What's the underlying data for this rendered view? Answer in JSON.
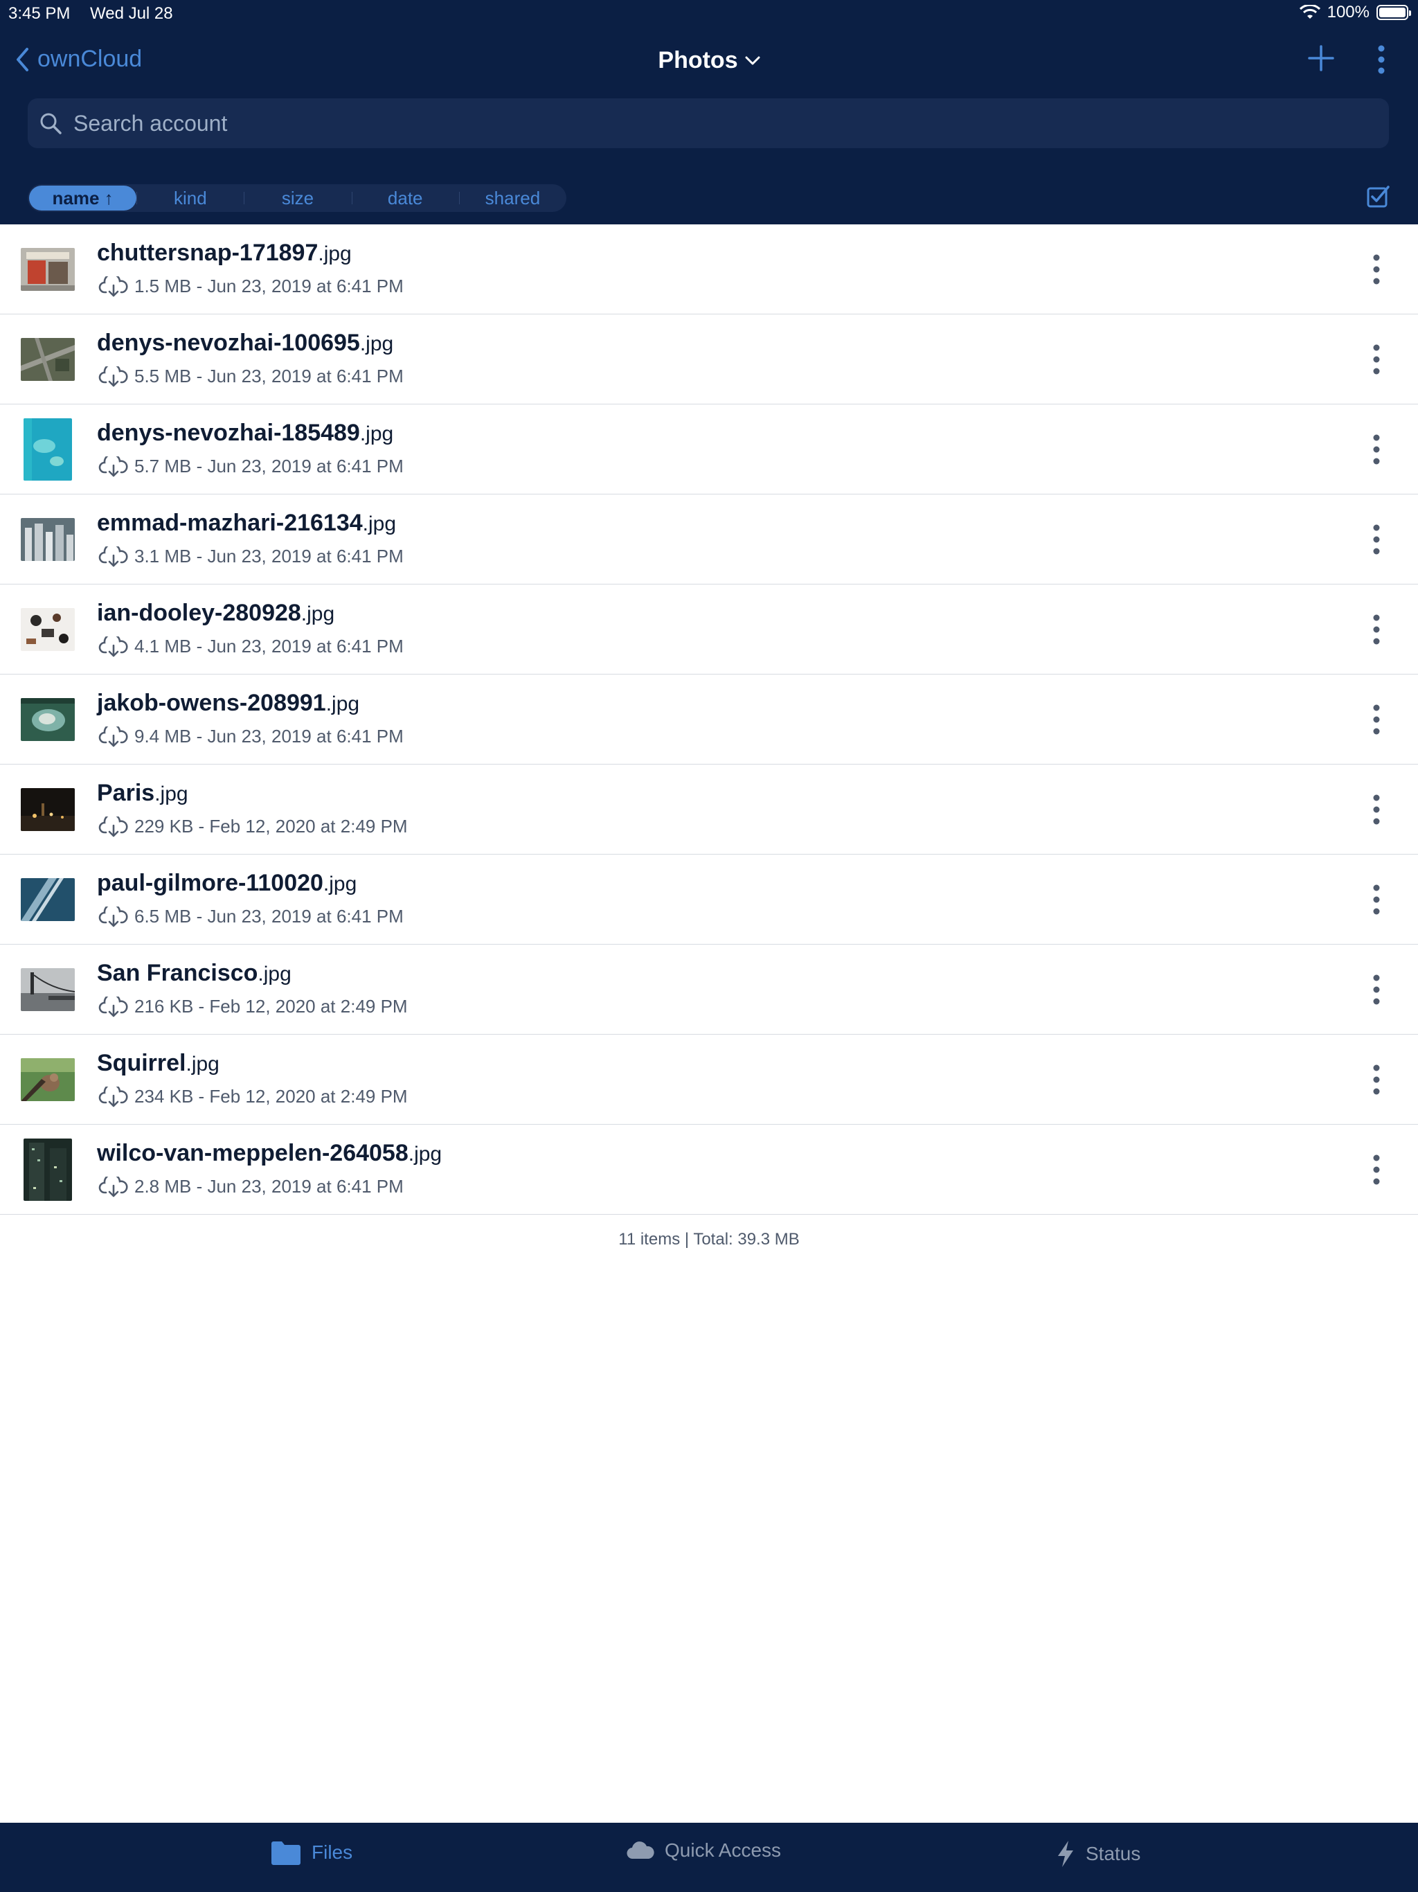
{
  "status_bar": {
    "time": "3:45 PM",
    "date": "Wed Jul 28",
    "battery": "100%",
    "battery_level": 1.0
  },
  "nav": {
    "back_label": "ownCloud",
    "title": "Photos"
  },
  "search": {
    "placeholder": "Search account"
  },
  "sort": {
    "items": [
      "name ↑",
      "kind",
      "size",
      "date",
      "shared"
    ],
    "active": "name"
  },
  "files": [
    {
      "base": "chuttersnap-171897",
      "ext": ".jpg",
      "meta": "1.5 MB - Jun 23, 2019 at 6:41 PM"
    },
    {
      "base": "denys-nevozhai-100695",
      "ext": ".jpg",
      "meta": "5.5 MB - Jun 23, 2019 at 6:41 PM"
    },
    {
      "base": "denys-nevozhai-185489",
      "ext": ".jpg",
      "meta": "5.7 MB - Jun 23, 2019 at 6:41 PM"
    },
    {
      "base": "emmad-mazhari-216134",
      "ext": ".jpg",
      "meta": "3.1 MB - Jun 23, 2019 at 6:41 PM"
    },
    {
      "base": "ian-dooley-280928",
      "ext": ".jpg",
      "meta": "4.1 MB - Jun 23, 2019 at 6:41 PM"
    },
    {
      "base": "jakob-owens-208991",
      "ext": ".jpg",
      "meta": "9.4 MB - Jun 23, 2019 at 6:41 PM"
    },
    {
      "base": "Paris",
      "ext": ".jpg",
      "meta": "229 KB - Feb 12, 2020 at 2:49 PM"
    },
    {
      "base": "paul-gilmore-110020",
      "ext": ".jpg",
      "meta": "6.5 MB - Jun 23, 2019 at 6:41 PM"
    },
    {
      "base": "San Francisco",
      "ext": ".jpg",
      "meta": "216 KB - Feb 12, 2020 at 2:49 PM"
    },
    {
      "base": "Squirrel",
      "ext": ".jpg",
      "meta": "234 KB - Feb 12, 2020 at 2:49 PM"
    },
    {
      "base": "wilco-van-meppelen-264058",
      "ext": ".jpg",
      "meta": "2.8 MB - Jun 23, 2019 at 6:41 PM"
    }
  ],
  "summary": "11 items | Total: 39.3 MB",
  "tabs": {
    "files": "Files",
    "quick_access": "Quick Access",
    "status": "Status"
  },
  "colors": {
    "header_bg": "#0b1f44",
    "accent": "#4a89d8",
    "search_bg": "#172b52"
  }
}
